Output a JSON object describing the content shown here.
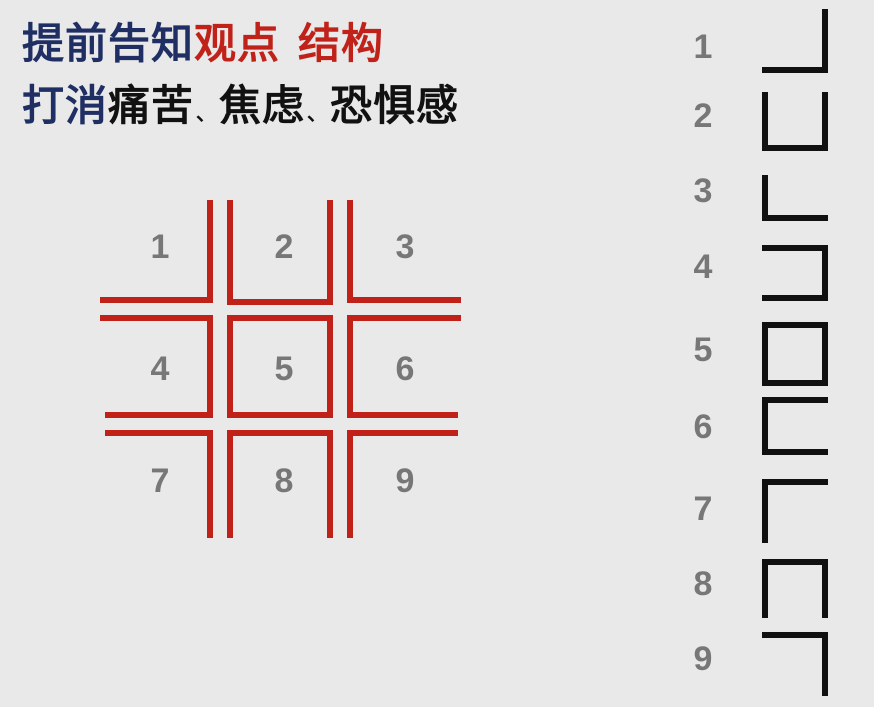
{
  "title": {
    "line1": {
      "part1": "提前告知",
      "part2": "观点",
      "part3": "结构"
    },
    "line2": {
      "part1": "打消",
      "item1": "痛苦",
      "sep1": "、",
      "item2": "焦虑",
      "sep2": "、",
      "item3": "恐惧感"
    }
  },
  "grid": {
    "cells": [
      "1",
      "2",
      "3",
      "4",
      "5",
      "6",
      "7",
      "8",
      "9"
    ],
    "line_color": "#c0221a"
  },
  "sequence": {
    "numbers": [
      "1",
      "2",
      "3",
      "4",
      "5",
      "6",
      "7",
      "8",
      "9"
    ],
    "glyph_color": "#111111"
  }
}
